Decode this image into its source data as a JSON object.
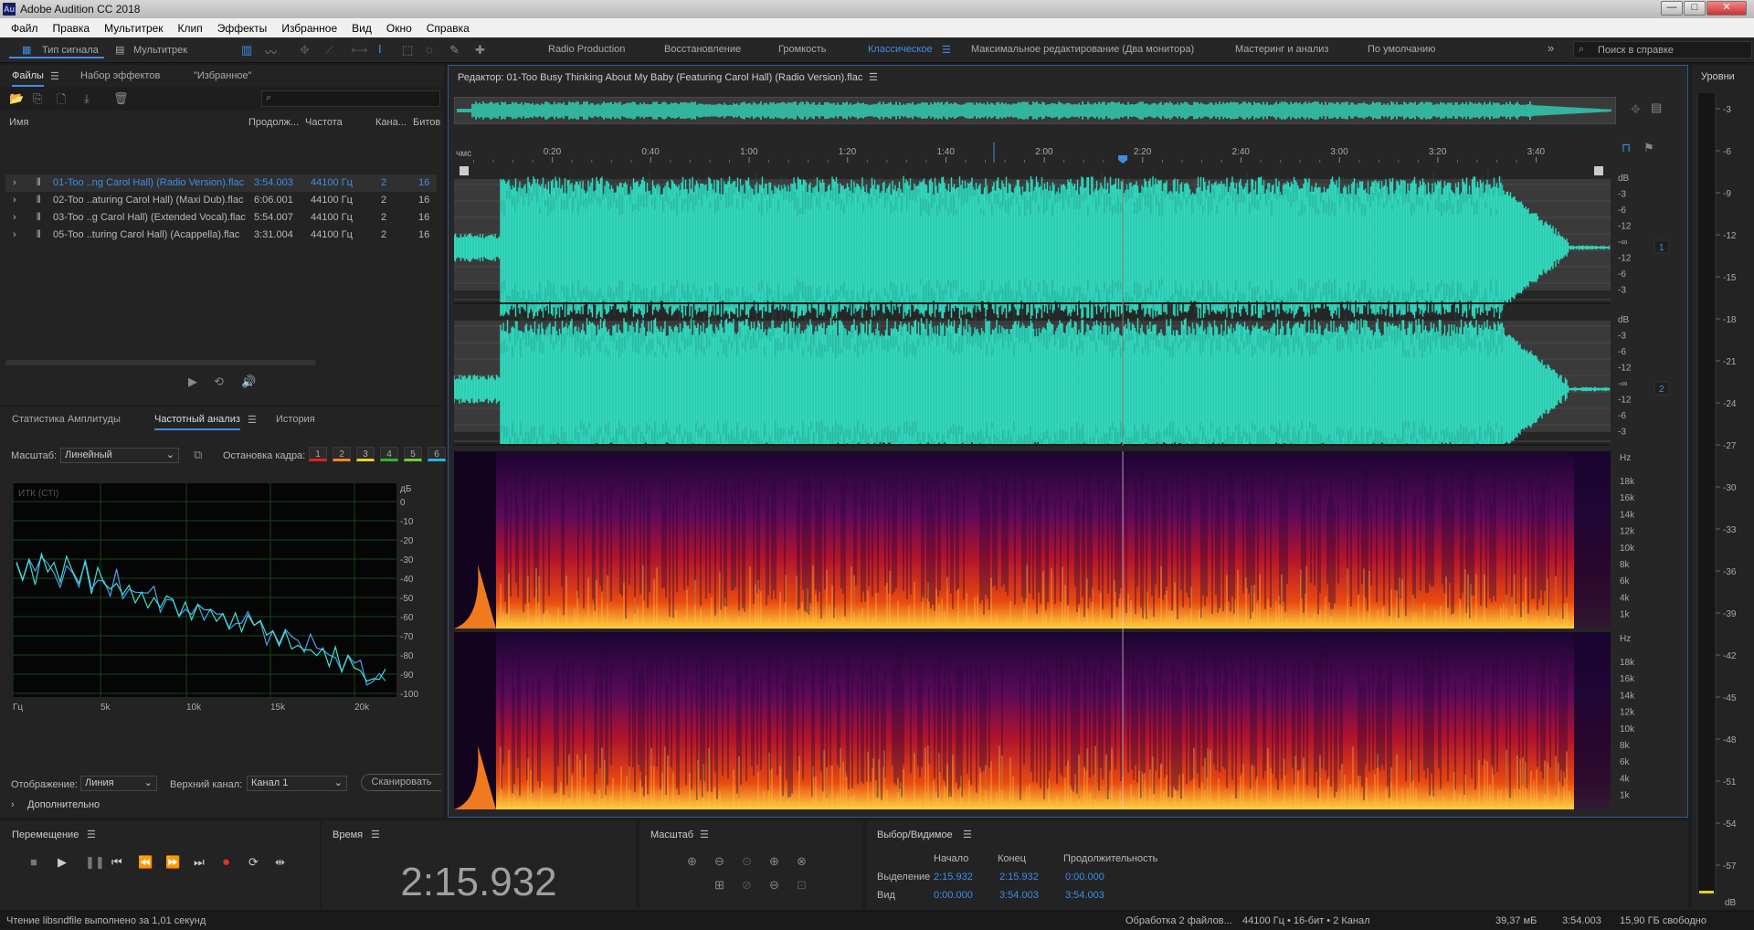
{
  "app": {
    "title": "Adobe Audition CC 2018",
    "logo": "Au"
  },
  "window_buttons": {
    "minimize": "—",
    "maximize": "□",
    "close": "✕"
  },
  "menu": [
    "Файл",
    "Правка",
    "Мультитрек",
    "Клип",
    "Эффекты",
    "Избранное",
    "Вид",
    "Окно",
    "Справка"
  ],
  "toolbar": {
    "mode_waveform": "Тип сигнала",
    "mode_multitrack": "Мультитрек",
    "workspaces": [
      "Radio Production",
      "Восстановление",
      "Громкость",
      "Классическое",
      "Максимальное редактирование (Два монитора)",
      "Мастеринг и анализ",
      "По умолчанию"
    ],
    "active_workspace": "Классическое",
    "more": "»",
    "help_search_placeholder": "Поиск в справке"
  },
  "files_panel": {
    "tabs": [
      "Файлы",
      "Набор эффектов",
      "\"Избранное\""
    ],
    "columns": [
      "Имя",
      "Продолж...",
      "Частота",
      "Кана...",
      "Битов"
    ],
    "rows": [
      {
        "name": "01-Too ..ng Carol Hall) (Radio Version).flac",
        "duration": "3:54.003",
        "rate": "44100 Гц",
        "channels": "2",
        "bits": "16"
      },
      {
        "name": "02-Too ..aturing Carol Hall) (Maxi Dub).flac",
        "duration": "6:06.001",
        "rate": "44100 Гц",
        "channels": "2",
        "bits": "16"
      },
      {
        "name": "03-Too ..g Carol Hall) (Extended Vocal).flac",
        "duration": "5:54.007",
        "rate": "44100 Гц",
        "channels": "2",
        "bits": "16"
      },
      {
        "name": "05-Too ..turing Carol Hall) (Acappella).flac",
        "duration": "3:31.004",
        "rate": "44100 Гц",
        "channels": "2",
        "bits": "16"
      }
    ]
  },
  "freq_panel": {
    "tabs": [
      "Статистика Амплитуды",
      "Частотный анализ",
      "История"
    ],
    "scale_label": "Масштаб:",
    "scale_value": "Линейный",
    "freeze_label": "Остановка кадра:",
    "freeze_slots": [
      "1",
      "2",
      "3",
      "4",
      "5",
      "6"
    ],
    "freeze_colors": [
      "#e02020",
      "#f08a1e",
      "#e6d21e",
      "#2fb82f",
      "#6fd02a",
      "#22b8e0"
    ],
    "graph_label": "ИТК (СТI)",
    "db_ticks": [
      "дБ",
      "0",
      "-10",
      "-20",
      "-30",
      "-40",
      "-50",
      "-60",
      "-70",
      "-80",
      "-90",
      "-100"
    ],
    "hz_ticks": [
      "Гц",
      "5k",
      "10k",
      "15k",
      "20k"
    ],
    "display_label": "Отображение:",
    "display_value": "Линия",
    "channel_label": "Верхний канал:",
    "channel_value": "Канал 1",
    "scan_button": "Сканировать",
    "advanced": "Дополнительно",
    "spectrum_values_db": [
      -32,
      -38,
      -30,
      -40,
      -28,
      -35,
      -33,
      -42,
      -30,
      -37,
      -40,
      -35,
      -45,
      -38,
      -42,
      -47,
      -40,
      -48,
      -44,
      -50,
      -46,
      -52,
      -48,
      -55,
      -50,
      -53,
      -57,
      -52,
      -58,
      -55,
      -60,
      -56,
      -62,
      -58,
      -64,
      -60,
      -66,
      -62,
      -68,
      -64,
      -70,
      -66,
      -73,
      -69,
      -75,
      -71,
      -78,
      -74,
      -80,
      -77,
      -83,
      -79,
      -85,
      -82,
      -88,
      -86,
      -91,
      -89,
      -93,
      -90
    ]
  },
  "editor": {
    "title": "Редактор: 01-Too Busy Thinking About My Baby (Featuring Carol Hall) (Radio Version).flac",
    "timeline_unit": "чмс",
    "time_ticks": [
      "0:20",
      "0:40",
      "1:00",
      "1:20",
      "1:40",
      "2:00",
      "2:20",
      "2:40",
      "3:00",
      "3:20",
      "3:40"
    ],
    "db_scale": [
      "dB",
      "-3",
      "-6",
      "-12",
      "-∞",
      "-12",
      "-6",
      "-3"
    ],
    "channels": [
      "1",
      "2"
    ],
    "hz_scale": [
      "Hz",
      "18k",
      "16k",
      "14k",
      "12k",
      "10k",
      "8k",
      "6k",
      "4k",
      "1k"
    ],
    "waveform_color": "#30dcc0",
    "playhead_fraction": 0.581
  },
  "levels": {
    "title": "Уровни",
    "ticks": [
      "-3",
      "-6",
      "-9",
      "-12",
      "-15",
      "-18",
      "-21",
      "-24",
      "-27",
      "-30",
      "-33",
      "-36",
      "-39",
      "-42",
      "-45",
      "-48",
      "-51",
      "-54",
      "-57"
    ],
    "db_label": "dB"
  },
  "transport": {
    "title": "Перемещение"
  },
  "time_panel": {
    "title": "Время",
    "value": "2:15.932"
  },
  "zoom_panel": {
    "title": "Масштаб"
  },
  "selection_panel": {
    "title": "Выбор/Видимое",
    "headers": [
      "Начало",
      "Конец",
      "Продолжительность"
    ],
    "rows": [
      {
        "label": "Выделение",
        "start": "2:15.932",
        "end": "2:15.932",
        "duration": "0:00.000"
      },
      {
        "label": "Вид",
        "start": "0:00.000",
        "end": "3:54.003",
        "duration": "3:54.003"
      }
    ]
  },
  "status": {
    "message": "Чтение libsndfile выполнено за 1,01 секунд",
    "processing": "Обработка 2 файлов...",
    "format": "44100 Гц • 16-бит • 2 Канал",
    "size": "39,37 мБ",
    "duration": "3:54.003",
    "free": "15,90 ГБ свободно"
  }
}
